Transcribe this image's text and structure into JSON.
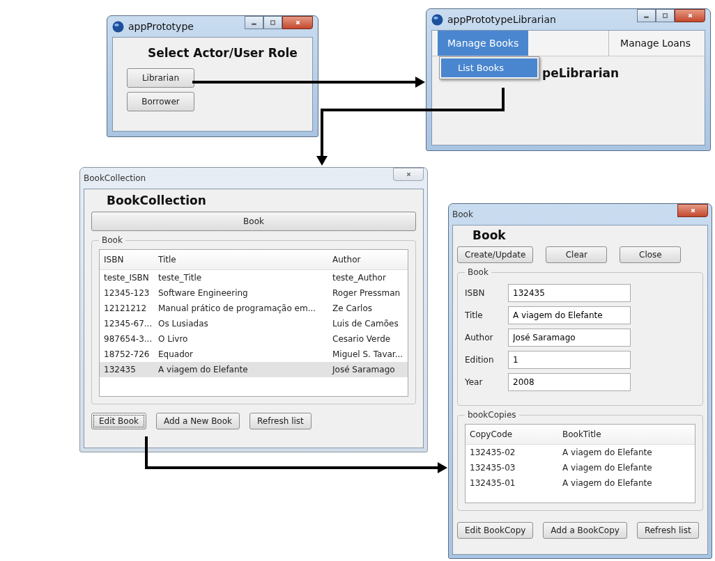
{
  "role_window": {
    "title": "appPrototype",
    "heading": "Select Actor/User Role",
    "buttons": [
      "Librarian",
      "Borrower"
    ]
  },
  "librarian_window": {
    "title": "appPrototypeLibrarian",
    "menus": [
      {
        "label": "Manage Books",
        "selected": true
      },
      {
        "label": "Manage Loans",
        "selected": false
      }
    ],
    "dropdown": [
      {
        "label": "List Books",
        "selected": true
      }
    ],
    "heading": "peLibrarian"
  },
  "collection_window": {
    "title": "BookCollection",
    "heading": "BookCollection",
    "tab": "Book",
    "group": "Book",
    "columns": [
      "ISBN",
      "Title",
      "Author"
    ],
    "rows": [
      {
        "cells": [
          "teste_ISBN",
          "teste_Title",
          "teste_Author"
        ],
        "selected": false
      },
      {
        "cells": [
          "12345-123",
          "Software Engineering",
          "Roger Pressman"
        ],
        "selected": false
      },
      {
        "cells": [
          "12121212",
          "Manual prático de programação em...",
          "Ze Carlos"
        ],
        "selected": false
      },
      {
        "cells": [
          "12345-67...",
          "Os Lusiadas",
          "Luis de Camões"
        ],
        "selected": false
      },
      {
        "cells": [
          "987654-3...",
          "O Livro",
          "Cesario Verde"
        ],
        "selected": false
      },
      {
        "cells": [
          "18752-726",
          "Equador",
          "Miguel S. Tavar..."
        ],
        "selected": false
      },
      {
        "cells": [
          "132435",
          "A viagem do Elefante",
          "José Saramago"
        ],
        "selected": true
      }
    ],
    "buttons": [
      {
        "label": "Edit Book",
        "focused": true
      },
      {
        "label": "Add a New Book",
        "focused": false
      },
      {
        "label": "Refresh list",
        "focused": false
      }
    ]
  },
  "book_window": {
    "title": "Book",
    "heading": "Book",
    "buttons": [
      "Create/Update",
      "Clear",
      "Close"
    ],
    "group": "Book",
    "fields": [
      {
        "label": "ISBN",
        "value": "132435"
      },
      {
        "label": "Title",
        "value": "A viagem do Elefante"
      },
      {
        "label": "Author",
        "value": "José Saramago"
      },
      {
        "label": "Edition",
        "value": "1"
      },
      {
        "label": "Year",
        "value": "2008"
      }
    ],
    "copies_group": "bookCopies",
    "columns": [
      "CopyCode",
      "BookTitle"
    ],
    "rows": [
      [
        "132435-02",
        "A viagem do Elefante"
      ],
      [
        "132435-03",
        "A viagem do Elefante"
      ],
      [
        "132435-01",
        "A viagem do Elefante"
      ]
    ],
    "bottom_buttons": [
      "Edit BookCopy",
      "Add a BookCopy",
      "Refresh list"
    ]
  }
}
